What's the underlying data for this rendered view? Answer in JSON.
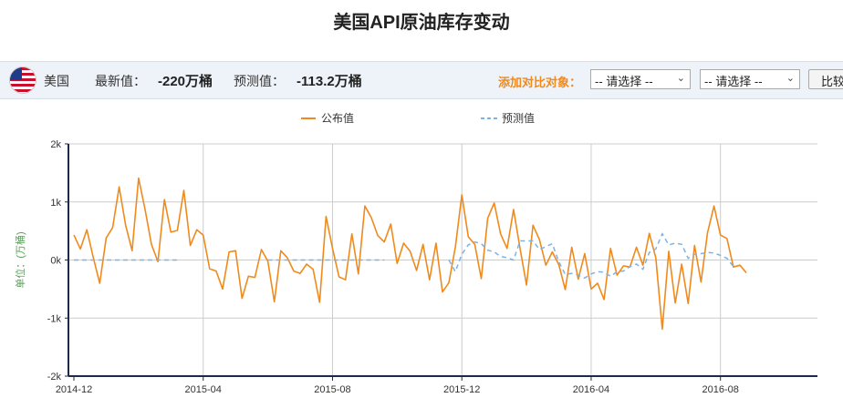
{
  "page_title": "美国API原油库存变动",
  "toolbar": {
    "country": "美国",
    "latest_label": "最新值：",
    "latest_value": "-220万桶",
    "forecast_label": "预测值：",
    "forecast_value": "-113.2万桶",
    "compare_label": "添加对比对象：",
    "select1": "-- 请选择 --",
    "select2": "-- 请选择 --",
    "compare_button": "比较",
    "flag_icon": "us-flag-icon"
  },
  "colors": {
    "actual": "#f08a1c",
    "forecast": "#7fb2e2",
    "axis": "#1f2a4a",
    "grid": "#cccccc"
  },
  "chart_data": {
    "type": "line",
    "ylabel": "单位：(万桶)",
    "ylim": [
      -2000,
      2000
    ],
    "yticks": [
      2000,
      1000,
      0,
      -1000,
      -2000
    ],
    "ytick_labels": [
      "2k",
      "1k",
      "0k",
      "-1k",
      "-2k"
    ],
    "xticks": [
      {
        "week": 0,
        "label": "2014-12"
      },
      {
        "week": 20,
        "label": "2015-04"
      },
      {
        "week": 40,
        "label": "2015-08"
      },
      {
        "week": 60,
        "label": "2015-12"
      },
      {
        "week": 80,
        "label": "2016-04"
      },
      {
        "week": 100,
        "label": "2016-08"
      }
    ],
    "x_step": "weekly",
    "x_max": 115,
    "legend": {
      "position": "top-center",
      "items": [
        "公布值",
        "预测值"
      ]
    },
    "grid": true,
    "series": [
      {
        "name": "公布值",
        "style": "solid",
        "values": [
          430,
          190,
          520,
          40,
          -400,
          380,
          560,
          1260,
          600,
          160,
          1410,
          870,
          270,
          -30,
          1040,
          480,
          510,
          1200,
          250,
          520,
          430,
          -150,
          -190,
          -500,
          140,
          160,
          -660,
          -280,
          -300,
          180,
          -20,
          -720,
          160,
          40,
          -190,
          -230,
          -70,
          -160,
          -730,
          750,
          200,
          -290,
          -340,
          450,
          -240,
          930,
          730,
          420,
          310,
          620,
          -60,
          290,
          150,
          -180,
          270,
          -340,
          290,
          -550,
          -390,
          220,
          1120,
          400,
          270,
          -320,
          720,
          980,
          450,
          200,
          870,
          200,
          -430,
          600,
          350,
          -90,
          140,
          -80,
          -510,
          220,
          -330,
          110,
          -500,
          -400,
          -680,
          200,
          -260,
          -100,
          -120,
          220,
          -90,
          460,
          40,
          -1190,
          150,
          -740,
          -70,
          -750,
          250,
          -380,
          470,
          930,
          430,
          370,
          -120,
          -90,
          -220
        ],
        "week_offset": 0
      },
      {
        "name": "预测值",
        "style": "dashed",
        "segments": [
          {
            "start_week": 0,
            "values": [
              0,
              0,
              0,
              0,
              0,
              0,
              0,
              0,
              0,
              0,
              0,
              0,
              0,
              0,
              0,
              0,
              0
            ]
          },
          {
            "start_week": 30,
            "values": [
              0,
              0,
              0,
              0,
              0,
              0,
              0,
              0,
              0,
              0,
              0,
              0,
              0,
              0,
              0,
              0,
              0,
              0,
              0
            ]
          },
          {
            "start_week": 58,
            "values": [
              0,
              -200,
              100,
              260,
              310,
              280,
              170,
              140,
              60,
              40,
              0,
              330,
              330,
              330,
              180,
              230,
              280,
              -30,
              -250,
              -230,
              -260,
              -310,
              -240,
              -200,
              -210,
              -280,
              -200,
              -190,
              -110,
              -70,
              -160,
              130,
              190,
              450,
              260,
              290,
              270,
              30,
              100,
              110,
              130,
              120,
              80,
              30,
              -113.2
            ]
          }
        ]
      }
    ]
  }
}
